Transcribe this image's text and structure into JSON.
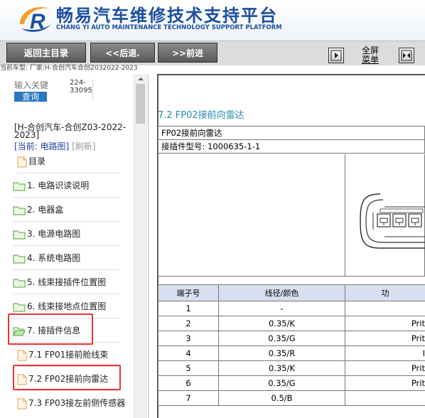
{
  "header": {
    "brand_cn": "畅易汽车维修技术支持平台",
    "brand_en": "CHANG YI AUTO MAINTENANCE TECHNOLOGY SUPPORT PLATFORM",
    "logo_letter": "R"
  },
  "toolbar": {
    "home_label": "返回主目录",
    "back_label": "<<后退.",
    "forward_label": ">>前进",
    "fullscreen_label_1": "全屏",
    "fullscreen_label_2": "菜单"
  },
  "model_line": "当前车型: 厂家:H-合创汽车合创Z032022-2023",
  "sidebar": {
    "search_placeholder": "输入关键",
    "search_button": "查询",
    "search_hint": "224-33095",
    "vehicle_title": "[H-合创汽车-合创Z03-2022-2023]",
    "current_prefix": "[当前: 电路图]",
    "refresh_label": "[刷新]",
    "items": [
      {
        "label": "目录"
      },
      {
        "label": "1. 电路识读说明"
      },
      {
        "label": "2. 电器盒"
      },
      {
        "label": "3. 电源电路图"
      },
      {
        "label": "4. 系统电路图"
      },
      {
        "label": "5. 线束接插件位置图"
      },
      {
        "label": "6. 线束接地点位置图"
      },
      {
        "label": "7. 接插件信息"
      },
      {
        "label": "7.1 FP01接前舱线束"
      },
      {
        "label": "7.2 FP02接前向雷达"
      },
      {
        "label": "7.3 FP03接左前侧传感器"
      }
    ]
  },
  "main": {
    "section_title": "7.2 FP02接前向雷达",
    "connector_name": "FP02接前向雷达",
    "connector_model": "接插件型号: 1000635-1-1",
    "table_headers": [
      "端子号",
      "线径/颜色",
      "功"
    ],
    "rows": [
      {
        "pin": "1",
        "wire": "-",
        "func": ""
      },
      {
        "pin": "2",
        "wire": "0.35/K",
        "func": "Prit"
      },
      {
        "pin": "3",
        "wire": "0.35/G",
        "func": "Prit"
      },
      {
        "pin": "4",
        "wire": "0.35/R",
        "func": "I"
      },
      {
        "pin": "5",
        "wire": "0.35/K",
        "func": "Prit"
      },
      {
        "pin": "6",
        "wire": "0.35/G",
        "func": "Prit"
      },
      {
        "pin": "7",
        "wire": "0.5/B",
        "func": ""
      }
    ]
  },
  "colors": {
    "brand_blue": "#1c4fa0",
    "accent_orange": "#f0a030",
    "title_teal": "#2a8ab3",
    "highlight_red": "#e33333",
    "table_header_bg": "#d9dff0"
  }
}
